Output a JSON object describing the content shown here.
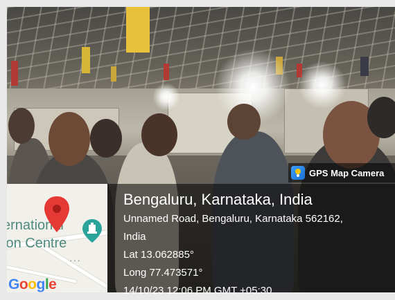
{
  "overlay": {
    "app_name": "GPS Map Camera",
    "app_icon": "gps-map-camera-icon",
    "location_title": "Bengaluru, Karnataka, India",
    "address_line1": "Unnamed Road, Bengaluru, Karnataka 562162,",
    "address_line2": "India",
    "latitude": "Lat 13.062885°",
    "longitude": "Long 77.473571°",
    "timestamp_partial": "14/10/23 12:06 PM GMT +05:30"
  },
  "map": {
    "place_label_line1": "ernational",
    "place_label_line2": "ion Centre",
    "brand": [
      "G",
      "o",
      "o",
      "g",
      "l",
      "e"
    ],
    "pin_icon": "map-pin-icon",
    "poi_icon": "poi-landmark-icon",
    "colors": {
      "pin": "#E53935",
      "poi": "#2aa39a",
      "label": "#4e8a7f"
    }
  }
}
